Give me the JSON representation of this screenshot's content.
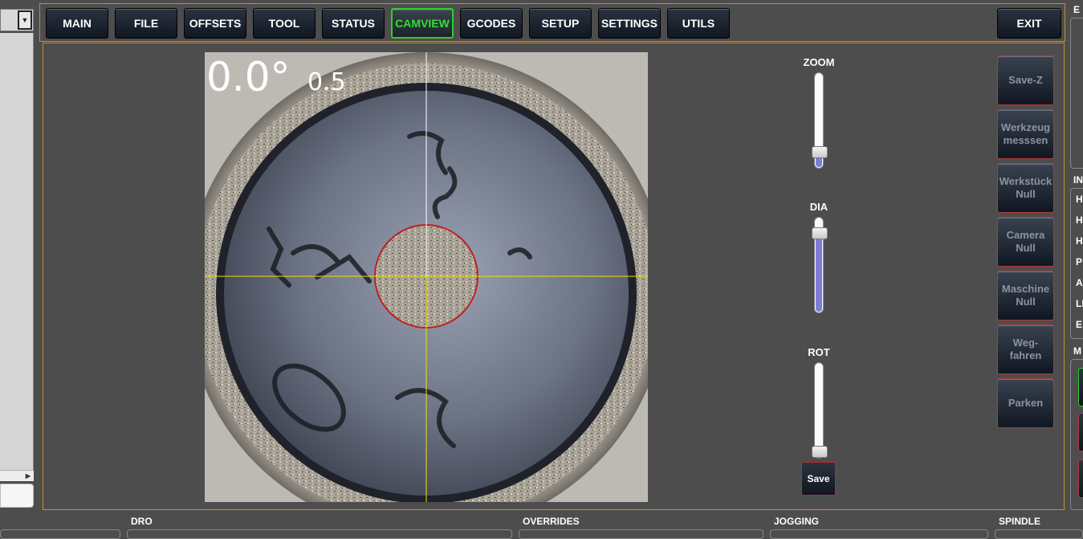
{
  "tabs": [
    {
      "label": "MAIN",
      "active": false
    },
    {
      "label": "FILE",
      "active": false
    },
    {
      "label": "OFFSETS",
      "active": false
    },
    {
      "label": "TOOL",
      "active": false
    },
    {
      "label": "STATUS",
      "active": false
    },
    {
      "label": "CAMVIEW",
      "active": true
    },
    {
      "label": "GCODES",
      "active": false
    },
    {
      "label": "SETUP",
      "active": false
    },
    {
      "label": "SETTINGS",
      "active": false
    },
    {
      "label": "UTILS",
      "active": false
    }
  ],
  "exit_label": "EXIT",
  "camview": {
    "angle_text": "0.0°",
    "zoom_text": "0.5",
    "sliders": [
      {
        "label": "ZOOM",
        "fill_fraction": 0.12
      },
      {
        "label": "DIA",
        "fill_fraction": 0.88
      },
      {
        "label": "ROT",
        "fill_fraction": 0.0
      }
    ],
    "save_label": "Save"
  },
  "side_buttons": [
    "Save-Z",
    "Werkzeug\nmesssen",
    "Werkstück\nNull",
    "Camera\nNull",
    "Maschine\nNull",
    "Weg-\nfahren",
    "Parken"
  ],
  "right_panel": {
    "title_top": "E",
    "title_info": "IN",
    "info_lines": [
      "H",
      "H",
      "H",
      "P",
      "A",
      "LI",
      "E"
    ],
    "title_bottom": "M"
  },
  "bottom_sections": [
    "DRO",
    "OVERRIDES",
    "JOGGING",
    "SPINDLE"
  ],
  "colors": {
    "background": "#4d4d4d",
    "frame_border": "#c98a2a",
    "active_tab": "#2ee02e",
    "button_border": "#b03a3a",
    "slider_fill": "#7e7ed6",
    "crosshair": "#f0e000",
    "circle": "#c02020"
  }
}
